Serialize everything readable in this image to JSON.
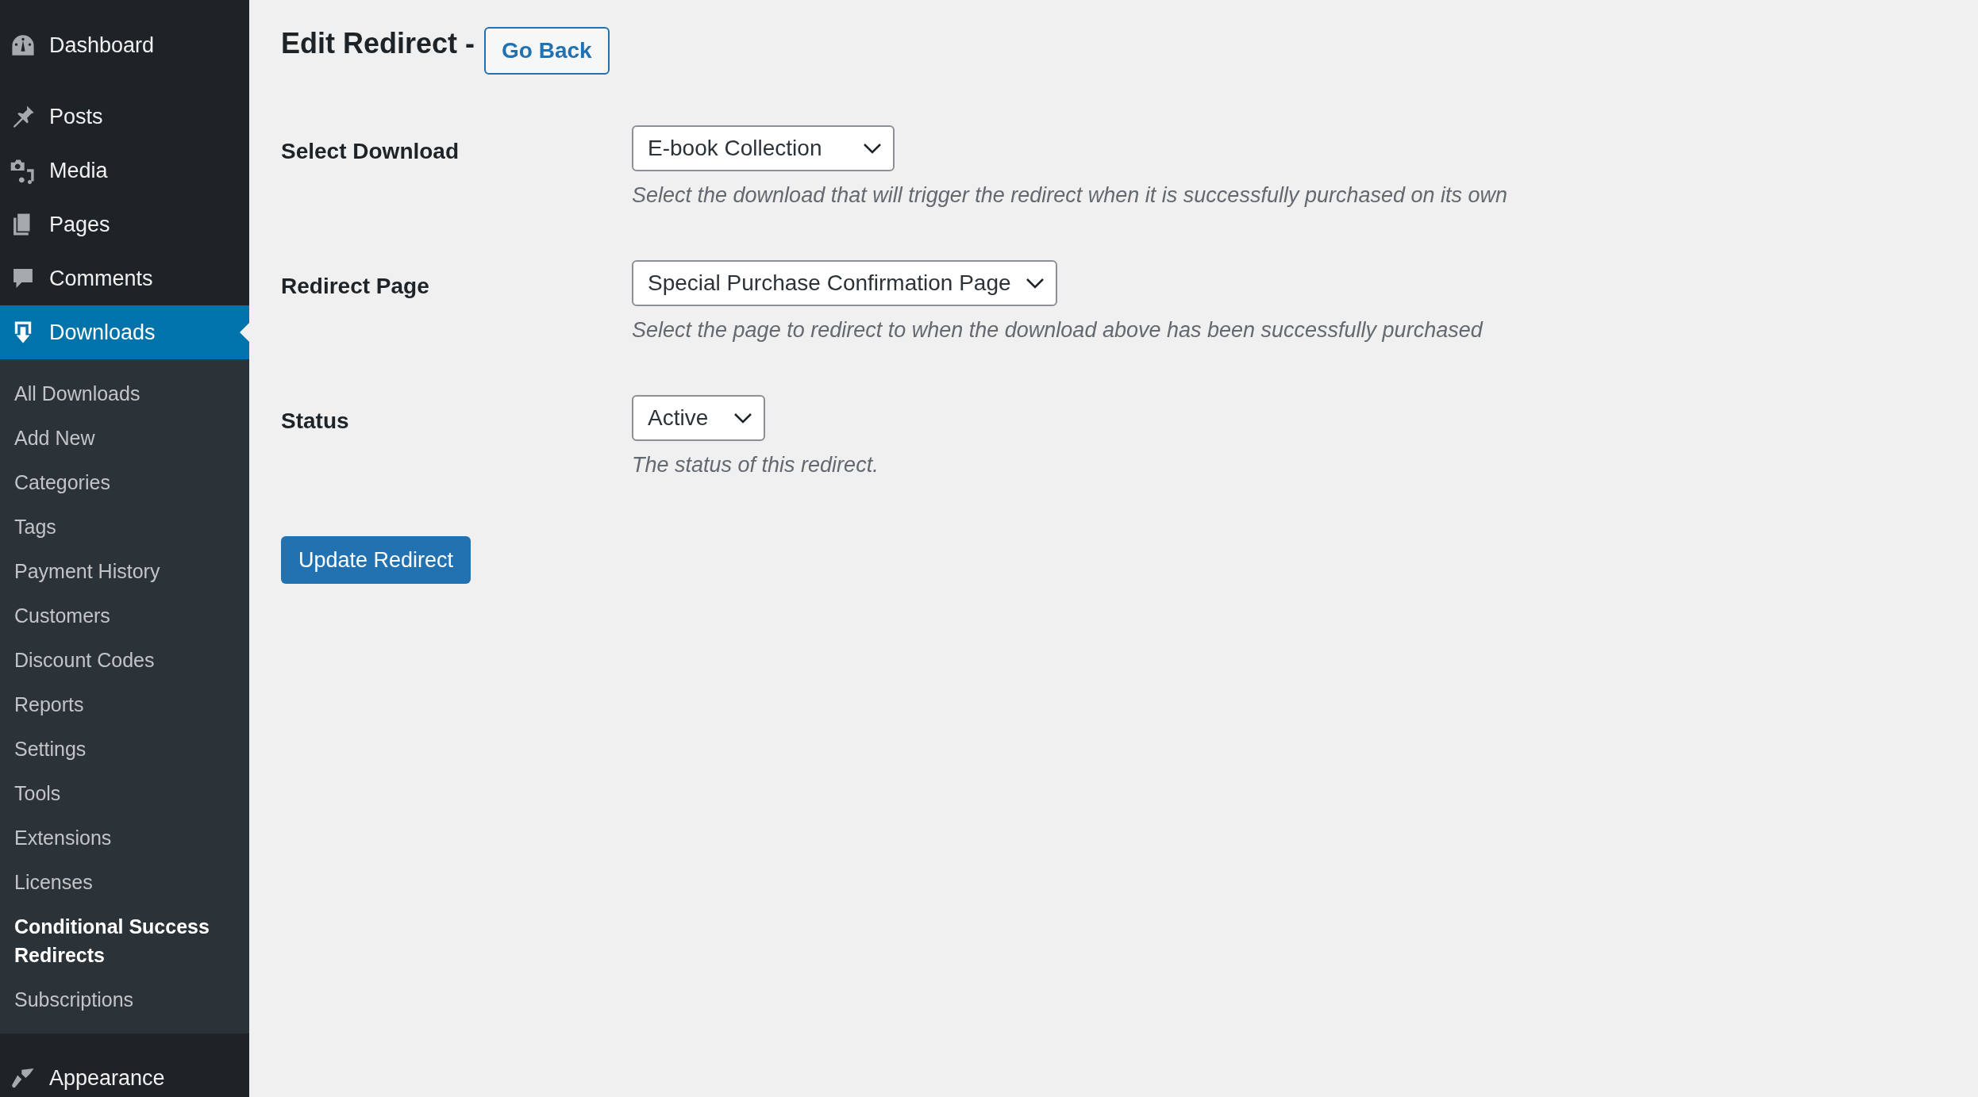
{
  "sidebar": {
    "items": [
      {
        "label": "Dashboard",
        "selected": false
      },
      {
        "label": "Posts",
        "selected": false
      },
      {
        "label": "Media",
        "selected": false
      },
      {
        "label": "Pages",
        "selected": false
      },
      {
        "label": "Comments",
        "selected": false
      },
      {
        "label": "Downloads",
        "selected": true,
        "children": [
          {
            "label": "All Downloads",
            "selected": false
          },
          {
            "label": "Add New",
            "selected": false
          },
          {
            "label": "Categories",
            "selected": false
          },
          {
            "label": "Tags",
            "selected": false
          },
          {
            "label": "Payment History",
            "selected": false
          },
          {
            "label": "Customers",
            "selected": false
          },
          {
            "label": "Discount Codes",
            "selected": false
          },
          {
            "label": "Reports",
            "selected": false
          },
          {
            "label": "Settings",
            "selected": false
          },
          {
            "label": "Tools",
            "selected": false
          },
          {
            "label": "Extensions",
            "selected": false
          },
          {
            "label": "Licenses",
            "selected": false
          },
          {
            "label": "Conditional Success Redirects",
            "selected": true
          },
          {
            "label": "Subscriptions",
            "selected": false
          }
        ]
      },
      {
        "label": "Appearance",
        "selected": false
      }
    ]
  },
  "page": {
    "title": "Edit Redirect -",
    "back_button": "Go Back"
  },
  "form": {
    "rows": [
      {
        "label": "Select Download",
        "value": "E-book Collection",
        "description": "Select the download that will trigger the redirect when it is successfully purchased on its own"
      },
      {
        "label": "Redirect Page",
        "value": "Special Purchase Confirmation Page",
        "description": "Select the page to redirect to when the download above has been successfully purchased"
      },
      {
        "label": "Status",
        "value": "Active",
        "description": "The status of this redirect."
      }
    ],
    "submit": "Update Redirect"
  }
}
